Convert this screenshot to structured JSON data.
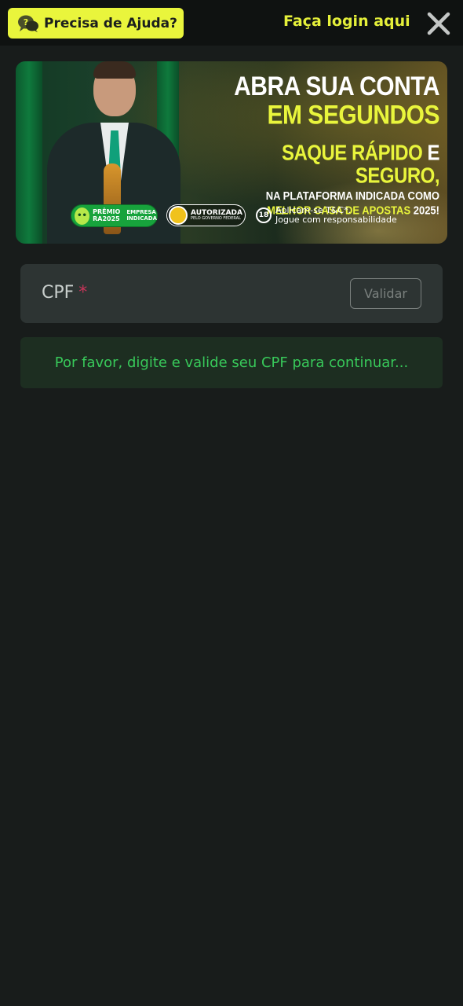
{
  "header": {
    "help_label": "Precisa de Ajuda?",
    "login_label": "Faça login aqui",
    "help_icon": "chat-help-icon",
    "close_icon": "close-icon"
  },
  "banner": {
    "headline_line1": "ABRA SUA CONTA",
    "headline_line2": "EM SEGUNDOS",
    "headline_line3_a": "SAQUE RÁPIDO",
    "headline_line3_b": " E ",
    "headline_line3_c": "SEGURO,",
    "headline_line4": "NA PLATAFORMA INDICADA COMO",
    "headline_line5_a": "MELHOR CASA DE APOSTAS",
    "headline_line5_b": " 2025!",
    "premio_label": "PRÊMIO",
    "premio_year": "2025",
    "premio_prefix": "RA",
    "empresa_label": "EMPRESA",
    "indicada_label": "INDICADA",
    "autorizada_label": "AUTORIZADA",
    "autorizada_sub": "PELO GOVERNO FEDERAL",
    "age_badge": "18",
    "terms_line1": "Aplicam-se T&C*.",
    "terms_line2": "Jogue com responsabilidade"
  },
  "form": {
    "cpf_label": "CPF",
    "required_mark": "*",
    "validate_label": "Validar",
    "notice_text": "Por favor, digite e valide seu CPF para continuar..."
  },
  "colors": {
    "accent": "#e9f53c",
    "background": "#181c1b",
    "notice_text": "#38c95a",
    "required": "#c8345a"
  }
}
